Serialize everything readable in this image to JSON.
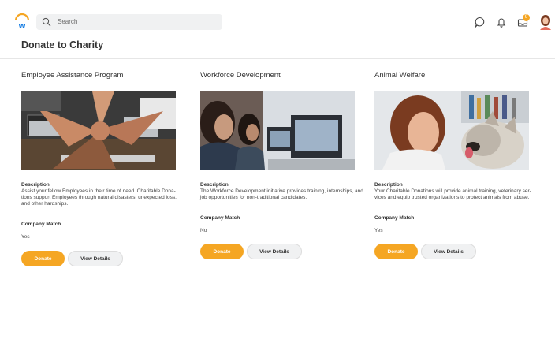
{
  "header": {
    "logo_icon": "workday-logo-icon",
    "search_placeholder": "Search",
    "icons": [
      "search-icon",
      "chat-icon",
      "bell-icon",
      "inbox-icon"
    ],
    "inbox_badge": "9",
    "brand_color": "#f5a623"
  },
  "page": {
    "title": "Donate to Charity"
  },
  "cards": [
    {
      "title": "Employee Assistance Program",
      "description_label": "Description",
      "description": "Assist your fellow Employees in their time of need. Charitable Dona-tions support Employees through natural disasters, unexpected loss, and other hardships.",
      "match_label": "Company Match",
      "match_value": "Yes",
      "donate_label": "Donate",
      "details_label": "View Details"
    },
    {
      "title": "Workforce Development",
      "description_label": "Description",
      "description": "The Workforce Development initiative provides training, internships, and job opportunities for non-traditional candidates.",
      "match_label": "Company Match",
      "match_value": "No",
      "donate_label": "Donate",
      "details_label": "View Details"
    },
    {
      "title": "Animal Welfare",
      "description_label": "Description",
      "description": "Your Charitable Donations will provide animal training, veterinary ser-vices and equip trusted organizations to protect animals from abuse.",
      "match_label": "Company Match",
      "match_value": "Yes",
      "donate_label": "Donate",
      "details_label": "View Details"
    }
  ]
}
